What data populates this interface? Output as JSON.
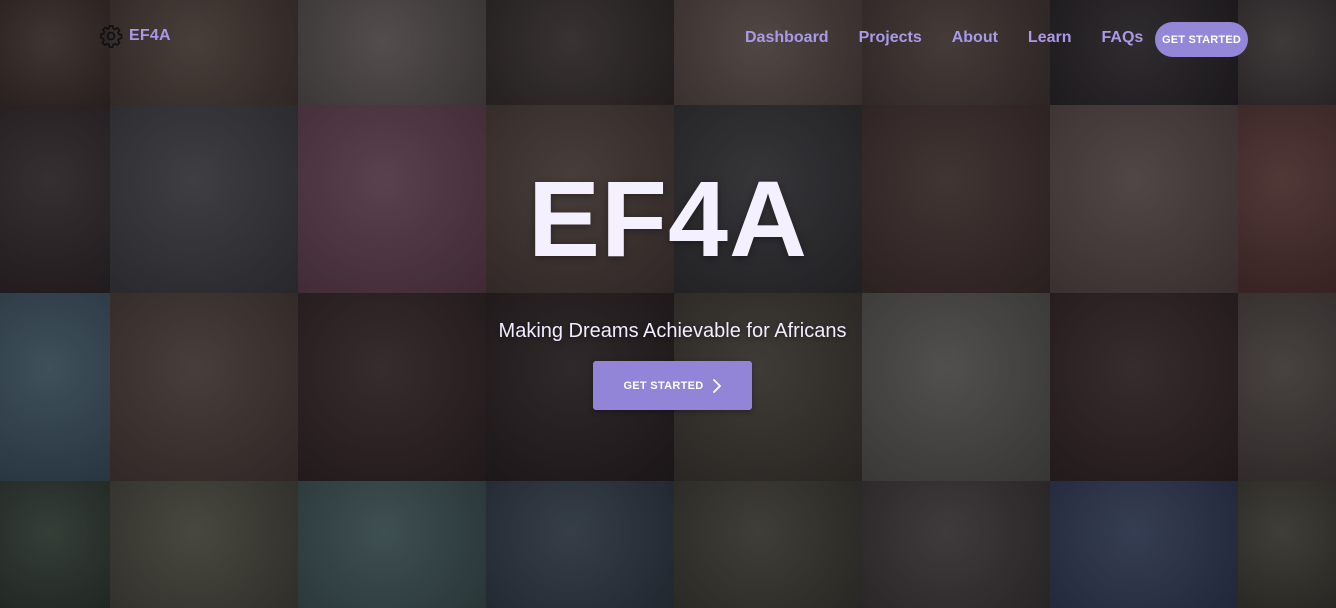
{
  "brand": {
    "name": "EF4A",
    "icon": "gear-icon",
    "color": "#a898e6"
  },
  "nav": {
    "links": [
      {
        "label": "Dashboard"
      },
      {
        "label": "Projects"
      },
      {
        "label": "About"
      },
      {
        "label": "Learn"
      },
      {
        "label": "FAQs"
      }
    ],
    "cta_label": "GET STARTED"
  },
  "hero": {
    "title": "EF4A",
    "subtitle": "Making Dreams Achievable for Africans",
    "cta_label": "GET STARTED",
    "cta_icon": "chevron-right-icon"
  },
  "theme": {
    "accent": "#9587d8",
    "nav_text": "#a99ae8",
    "hero_text": "#f4f0ff"
  },
  "background": {
    "tiles": [
      "#4a3a30",
      "#5a4a3e",
      "#6e6560",
      "#3e3530",
      "#6a5a50",
      "#55453c",
      "#2e2a2a",
      "#4a423e",
      "#3a3030",
      "#4a4a4e",
      "#7a5060",
      "#5a4a40",
      "#3a3a3a",
      "#4e3a32",
      "#6a5a52",
      "#6a4038",
      "#4a6a78",
      "#5a4a40",
      "#3a2a28",
      "#2e2422",
      "#4a4638",
      "#6a6a60",
      "#3a2a26",
      "#5a5048",
      "#3a4a3a",
      "#5a5a48",
      "#4a6a68",
      "#3a4a56",
      "#4a4a3a",
      "#4a4440",
      "#3a4a6a",
      "#4a4a3a"
    ]
  }
}
